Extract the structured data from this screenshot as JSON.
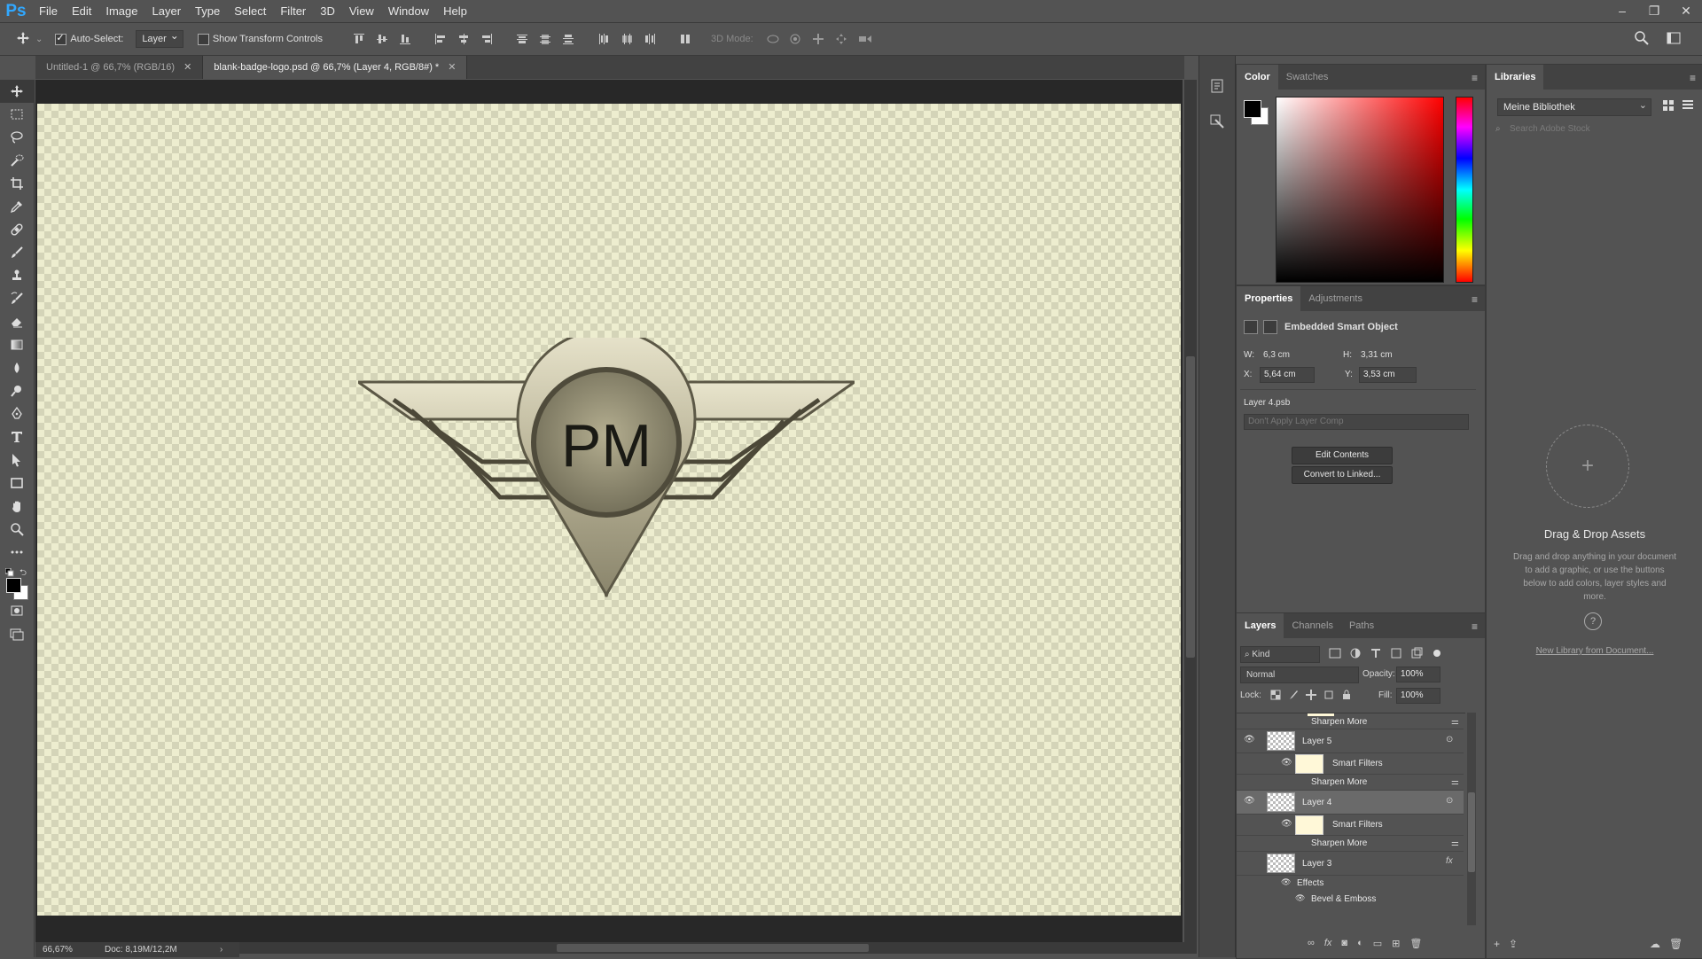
{
  "app": {
    "logo": "Ps",
    "menu": [
      "File",
      "Edit",
      "Image",
      "Layer",
      "Type",
      "Select",
      "Filter",
      "3D",
      "View",
      "Window",
      "Help"
    ]
  },
  "options": {
    "auto_select_label": "Auto-Select:",
    "auto_select_target": "Layer",
    "show_transform_label": "Show Transform Controls",
    "mode_3d_label": "3D Mode:"
  },
  "tabs": [
    {
      "label": "Untitled-1 @ 66,7% (RGB/16)",
      "active": false
    },
    {
      "label": "blank-badge-logo.psd @ 66,7% (Layer 4, RGB/8#) *",
      "active": true
    }
  ],
  "status": {
    "zoom": "66,67%",
    "doc": "Doc: 8,19M/12,2M"
  },
  "canvas": {
    "logo_text": "PM"
  },
  "color_panel": {
    "tabs": [
      "Color",
      "Swatches"
    ],
    "foreground": "#000000",
    "background": "#ffffff"
  },
  "properties": {
    "tabs": [
      "Properties",
      "Adjustments"
    ],
    "type": "Embedded Smart Object",
    "w_label": "W:",
    "w_value": "6,3 cm",
    "h_label": "H:",
    "h_value": "3,31 cm",
    "x_label": "X:",
    "x_value": "5,64 cm",
    "y_label": "Y:",
    "y_value": "3,53 cm",
    "source_file": "Layer 4.psb",
    "layer_comp": "Don't Apply Layer Comp",
    "edit_button": "Edit Contents",
    "convert_button": "Convert to Linked..."
  },
  "layers_panel": {
    "tabs": [
      "Layers",
      "Channels",
      "Paths"
    ],
    "filter": "Kind",
    "blend_mode": "Normal",
    "opacity_label": "Opacity:",
    "opacity_value": "100%",
    "lock_label": "Lock:",
    "fill_label": "Fill:",
    "fill_value": "100%",
    "rows": [
      {
        "label": "Sharpen More",
        "kind": "filter"
      },
      {
        "label": "Layer 5",
        "kind": "layer"
      },
      {
        "label": "Smart Filters",
        "kind": "smart"
      },
      {
        "label": "Sharpen More",
        "kind": "filter"
      },
      {
        "label": "Layer 4",
        "kind": "layer",
        "selected": true
      },
      {
        "label": "Smart Filters",
        "kind": "smart"
      },
      {
        "label": "Sharpen More",
        "kind": "filter"
      },
      {
        "label": "Layer 3",
        "kind": "layer"
      },
      {
        "label": "Effects",
        "kind": "effects"
      },
      {
        "label": "Bevel & Emboss",
        "kind": "effect"
      }
    ]
  },
  "libraries": {
    "title": "Libraries",
    "library_name": "Meine Bibliothek",
    "search_placeholder": "Search Adobe Stock",
    "drop_title": "Drag & Drop Assets",
    "drop_text": "Drag and drop anything in your document to add a graphic, or use the buttons below to add colors, layer styles and more.",
    "new_from_doc": "New Library from Document..."
  }
}
